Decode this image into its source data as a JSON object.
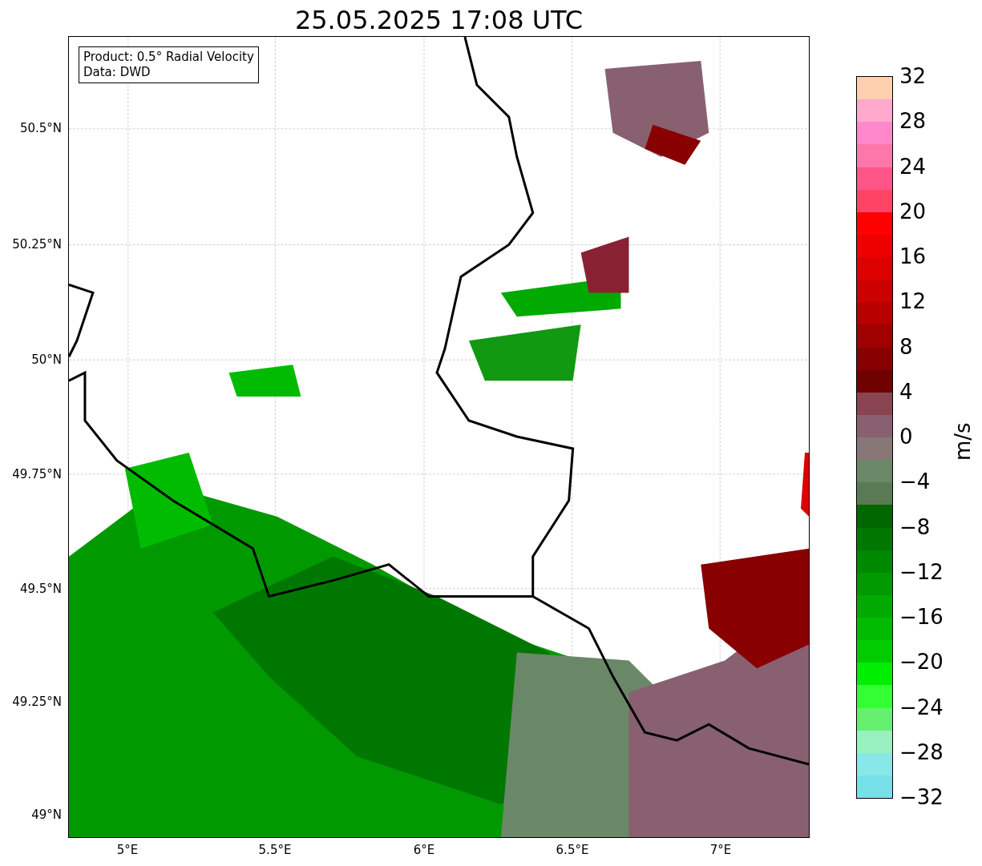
{
  "title": "25.05.2025 17:08 UTC",
  "info_box": [
    "Product: 0.5° Radial Velocity",
    "Data: DWD"
  ],
  "y_ticks": [
    "50.5°N",
    "50.25°N",
    "50°N",
    "49.75°N",
    "49.5°N",
    "49.25°N",
    "49°N"
  ],
  "x_ticks": [
    "5°E",
    "5.5°E",
    "6°E",
    "6.5°E",
    "7°E"
  ],
  "colorbar": {
    "label": "m/s",
    "ticks": [
      "32",
      "28",
      "24",
      "20",
      "16",
      "12",
      "8",
      "4",
      "0",
      "−4",
      "−8",
      "−12",
      "−16",
      "−20",
      "−24",
      "−28",
      "−32"
    ],
    "segments": [
      {
        "color": "#ffd0b0"
      },
      {
        "color": "#ffaacc"
      },
      {
        "color": "#ff88cc"
      },
      {
        "color": "#ff77aa"
      },
      {
        "color": "#ff5588"
      },
      {
        "color": "#ff4466"
      },
      {
        "color": "#ff0000"
      },
      {
        "color": "#ee0000"
      },
      {
        "color": "#dd0000"
      },
      {
        "color": "#cc0000"
      },
      {
        "color": "#b80000"
      },
      {
        "color": "#a00000"
      },
      {
        "color": "#880000"
      },
      {
        "color": "#6e0000"
      },
      {
        "color": "#884450"
      },
      {
        "color": "#886070"
      },
      {
        "color": "#887777"
      },
      {
        "color": "#6a8868"
      },
      {
        "color": "#5a7a55"
      },
      {
        "color": "#006600"
      },
      {
        "color": "#007700"
      },
      {
        "color": "#008800"
      },
      {
        "color": "#009900"
      },
      {
        "color": "#00aa00"
      },
      {
        "color": "#00bb00"
      },
      {
        "color": "#00cc00"
      },
      {
        "color": "#00ee00"
      },
      {
        "color": "#33ff33"
      },
      {
        "color": "#66f070"
      },
      {
        "color": "#99f0c0"
      },
      {
        "color": "#88e8e8"
      },
      {
        "color": "#77e0e8"
      }
    ]
  }
}
